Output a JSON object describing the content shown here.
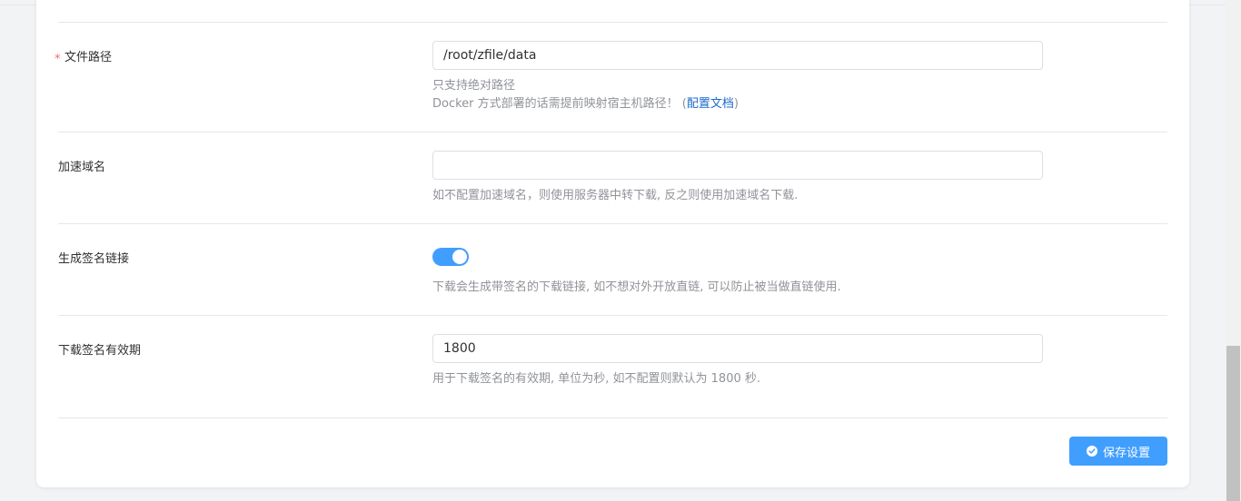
{
  "form": {
    "file_path": {
      "required_mark": "*",
      "label": "文件路径",
      "value": "/root/zfile/data",
      "help_line1": "只支持绝对路径",
      "help_line2_prefix": "Docker 方式部署的话需提前映射宿主机路径！ (",
      "help_link": "配置文档",
      "help_line2_suffix": ")"
    },
    "accel_domain": {
      "label": "加速域名",
      "value": "",
      "help": "如不配置加速域名，则使用服务器中转下载, 反之则使用加速域名下载."
    },
    "signed_link": {
      "label": "生成签名链接",
      "enabled": true,
      "help": "下载会生成带签名的下载链接, 如不想对外开放直链, 可以防止被当做直链使用."
    },
    "signature_expiry": {
      "label": "下载签名有效期",
      "value": "1800",
      "help": "用于下载签名的有效期, 单位为秒, 如不配置则默认为 1800 秒."
    }
  },
  "actions": {
    "save_label": "保存设置",
    "save_icon": "check-circle-icon"
  },
  "colors": {
    "accent": "#409eff",
    "required": "#f56c6c",
    "link": "#1d69c9",
    "tab_indicator": "#5b5fe0"
  }
}
